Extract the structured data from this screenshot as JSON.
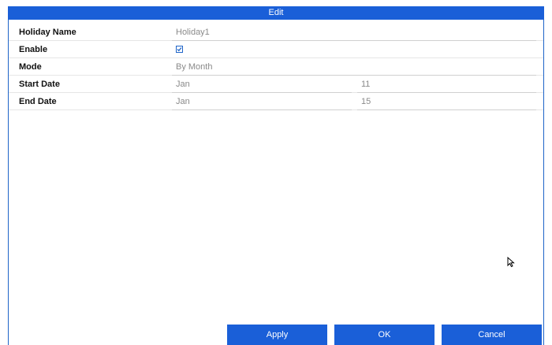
{
  "dialog": {
    "title": "Edit"
  },
  "fields": {
    "holiday_name": {
      "label": "Holiday Name",
      "value": "Holiday1"
    },
    "enable": {
      "label": "Enable",
      "checked": true
    },
    "mode": {
      "label": "Mode",
      "value": "By Month"
    },
    "start_date": {
      "label": "Start Date",
      "month": "Jan",
      "day": "11"
    },
    "end_date": {
      "label": "End Date",
      "month": "Jan",
      "day": "15"
    }
  },
  "buttons": {
    "apply": "Apply",
    "ok": "OK",
    "cancel": "Cancel"
  },
  "colors": {
    "accent": "#1a5fd8",
    "border": "#1e64c8",
    "value_text": "#8a8a8a"
  },
  "icons": {
    "checkbox": "checkmark-icon",
    "cursor": "mouse-pointer-icon"
  }
}
